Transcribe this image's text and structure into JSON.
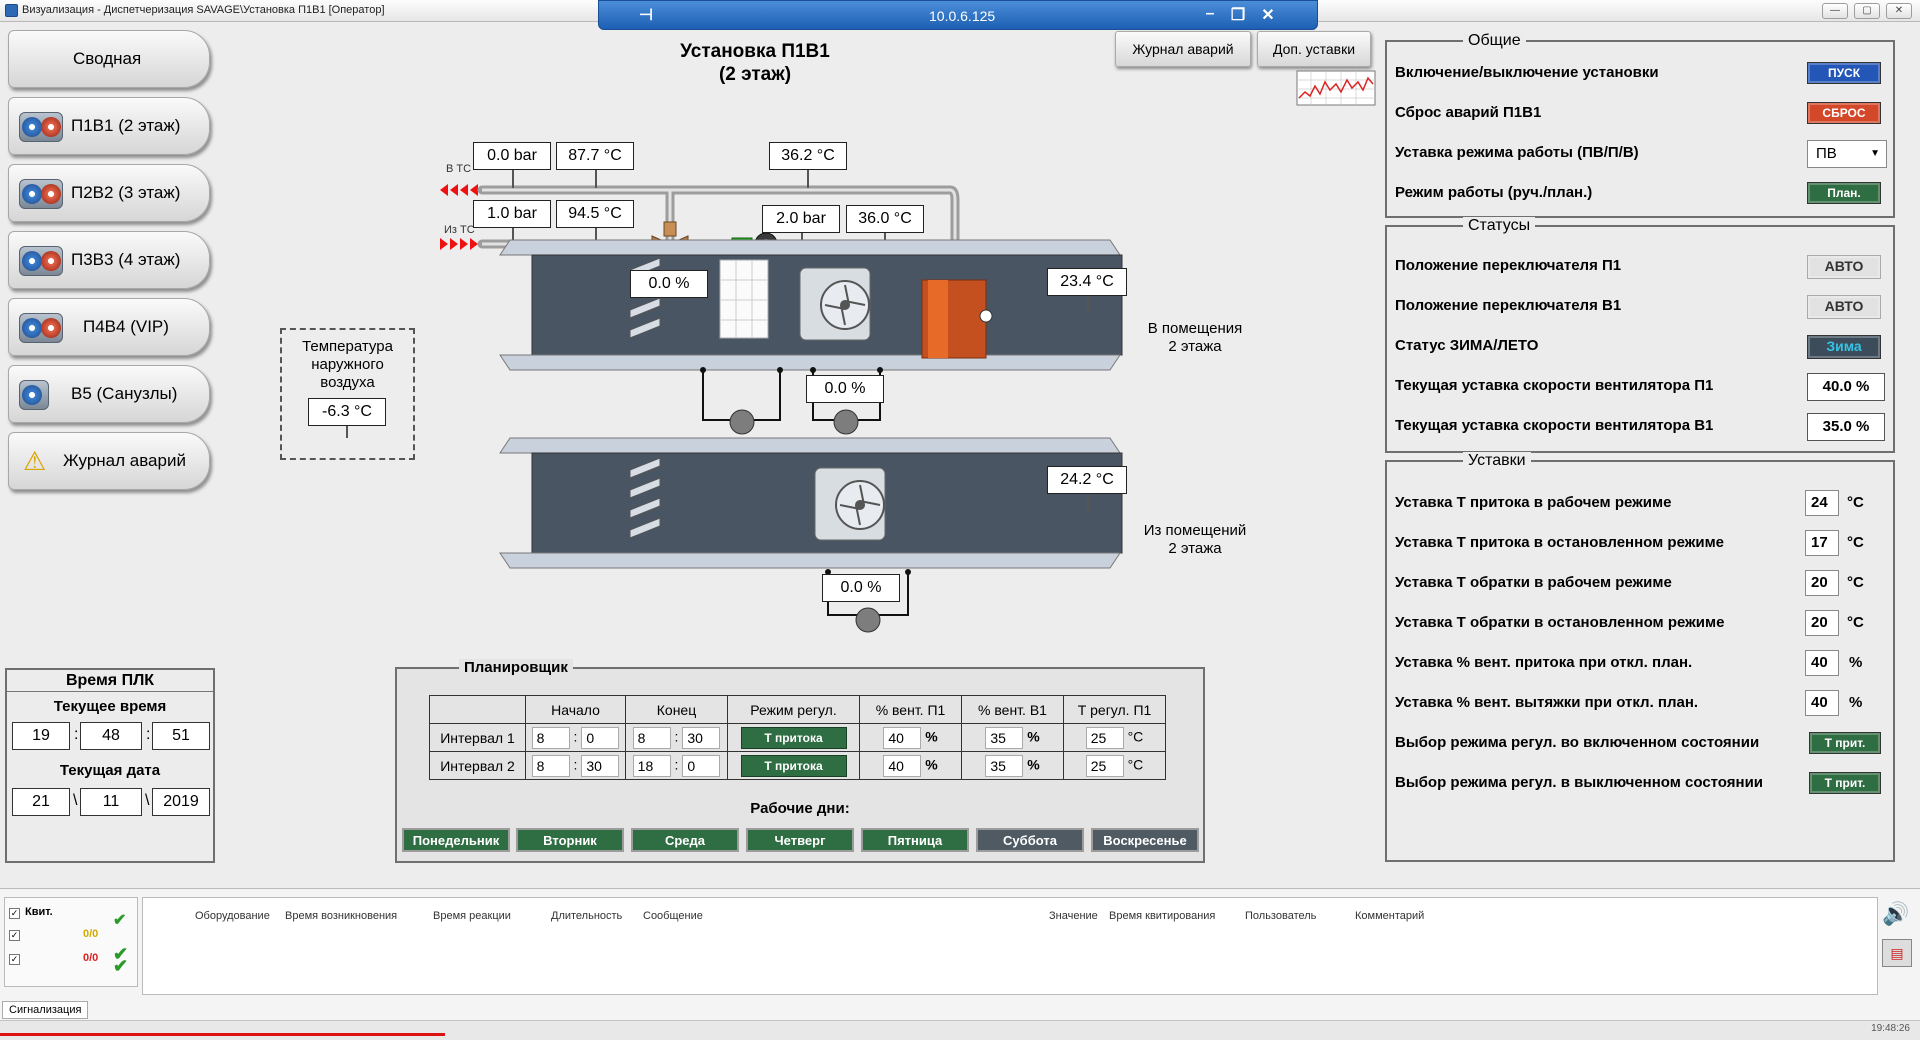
{
  "window": {
    "title": "Визуализация - Диспетчеризация SAVAGE\\Установка П1В1 [Оператор]",
    "remote_ip": "10.0.6.125"
  },
  "nav": {
    "items": [
      {
        "label": "Сводная",
        "icon": "none"
      },
      {
        "label": "П1В1 (2 этаж)",
        "icon": "fan-pair-icon"
      },
      {
        "label": "П2В2 (3 этаж)",
        "icon": "fan-pair-icon"
      },
      {
        "label": "П3В3 (4 этаж)",
        "icon": "fan-pair-icon"
      },
      {
        "label": "П4В4 (VIP)",
        "icon": "fan-pair-icon"
      },
      {
        "label": "В5 (Санузлы)",
        "icon": "fan-icon"
      },
      {
        "label": "Журнал аварий",
        "icon": "warning-icon"
      }
    ]
  },
  "header": {
    "title_line1": "Установка П1В1",
    "title_line2": "(2 этаж)",
    "alarm_log_btn": "Журнал аварий",
    "extra_settings_btn": "Доп. уставки"
  },
  "schematic": {
    "label_to_tc": "В ТС",
    "label_from_tc": "Из ТС",
    "supply_pressure": "0.0 bar",
    "supply_temp": "87.7 °C",
    "return_temp_top": "36.2 °C",
    "return_pressure_in": "1.0 bar",
    "return_temp_in": "94.5 °C",
    "pump_pressure": "2.0 bar",
    "pump_temp": "36.0 °C",
    "valve_pos": "0.0 %",
    "supply_air_temp": "23.4 °C",
    "supply_fan_speed": "0.0 %",
    "exhaust_air_temp": "24.2 °C",
    "exhaust_fan_speed": "0.0 %",
    "into_rooms": "В помещения\n2 этажа",
    "from_rooms": "Из помещений\n2 этажа",
    "outdoor_label": "Температура наружного воздуха",
    "outdoor_temp": "-6.3 °C"
  },
  "general": {
    "title": "Общие",
    "rows": [
      {
        "label": "Включение/выключение установки",
        "value": "ПУСК",
        "color": "#2456b8"
      },
      {
        "label": "Сброс аварий П1В1",
        "value": "СБРОС",
        "color": "#d4482a"
      },
      {
        "label": "Уставка режима работы (ПВ/П/В)",
        "value": "ПВ",
        "color": "#ffffff"
      },
      {
        "label": "Режим работы (руч./план.)",
        "value": "План.",
        "color": "#2f6d43"
      }
    ]
  },
  "statuses": {
    "title": "Статусы",
    "rows": [
      {
        "label": "Положение переключателя П1",
        "value": "АВТО"
      },
      {
        "label": "Положение переключателя В1",
        "value": "АВТО"
      },
      {
        "label": "Статус ЗИМА/ЛЕТО",
        "value": "Зима"
      },
      {
        "label": "Текущая уставка скорости вентилятора П1",
        "value": "40.0 %"
      },
      {
        "label": "Текущая уставка скорости вентилятора В1",
        "value": "35.0 %"
      }
    ]
  },
  "setpoints": {
    "title": "Уставки",
    "rows": [
      {
        "label": "Уставка Т притока в рабочем режиме",
        "value": "24",
        "unit": "°C"
      },
      {
        "label": "Уставка Т притока в остановленном режиме",
        "value": "17",
        "unit": "°C"
      },
      {
        "label": "Уставка Т обратки в рабочем режиме",
        "value": "20",
        "unit": "°C"
      },
      {
        "label": "Уставка Т обратки в остановленном режиме",
        "value": "20",
        "unit": "°C"
      },
      {
        "label": "Уставка % вент. притока при откл. план.",
        "value": "40",
        "unit": "%"
      },
      {
        "label": "Уставка % вент. вытяжки при откл. план.",
        "value": "40",
        "unit": "%"
      },
      {
        "label": "Выбор режима регул. во включенном состоянии",
        "button": "Т прит."
      },
      {
        "label": "Выбор режима регул. в выключенном состоянии",
        "button": "Т прит."
      }
    ]
  },
  "plc_time": {
    "title": "Время ПЛК",
    "time_label": "Текущее время",
    "hour": "19",
    "minute": "48",
    "second": "51",
    "date_label": "Текущая дата",
    "day": "21",
    "month": "11",
    "year": "2019"
  },
  "scheduler": {
    "title": "Планировщик",
    "headers": [
      "Начало",
      "Конец",
      "Режим регул.",
      "% вент. П1",
      "% вент. В1",
      "Т регул. П1"
    ],
    "rows": [
      {
        "name": "Интервал 1",
        "start_h": "8",
        "start_m": "0",
        "end_h": "8",
        "end_m": "30",
        "mode": "Т притока",
        "fan_p1": "40",
        "fan_v1": "35",
        "temp": "25"
      },
      {
        "name": "Интервал 2",
        "start_h": "8",
        "start_m": "30",
        "end_h": "18",
        "end_m": "0",
        "mode": "Т притока",
        "fan_p1": "40",
        "fan_v1": "35",
        "temp": "25"
      }
    ],
    "unit_pct": "%",
    "unit_deg": "°C",
    "workdays_label": "Рабочие дни:",
    "days": [
      {
        "label": "Понедельник",
        "active": true
      },
      {
        "label": "Вторник",
        "active": true
      },
      {
        "label": "Среда",
        "active": true
      },
      {
        "label": "Четверг",
        "active": true
      },
      {
        "label": "Пятница",
        "active": true
      },
      {
        "label": "Суббота",
        "active": false
      },
      {
        "label": "Воскресенье",
        "active": false
      }
    ]
  },
  "alarms": {
    "ack_label": "Квит.",
    "count1": "0/0",
    "count2": "0/0",
    "columns": [
      "Оборудование",
      "Время возникновения",
      "Время реакции",
      "Длительность",
      "Сообщение",
      "Значение",
      "Время квитирования",
      "Пользователь",
      "Комментарий"
    ],
    "tab": "Сигнализация",
    "clock": "19:48:26"
  }
}
